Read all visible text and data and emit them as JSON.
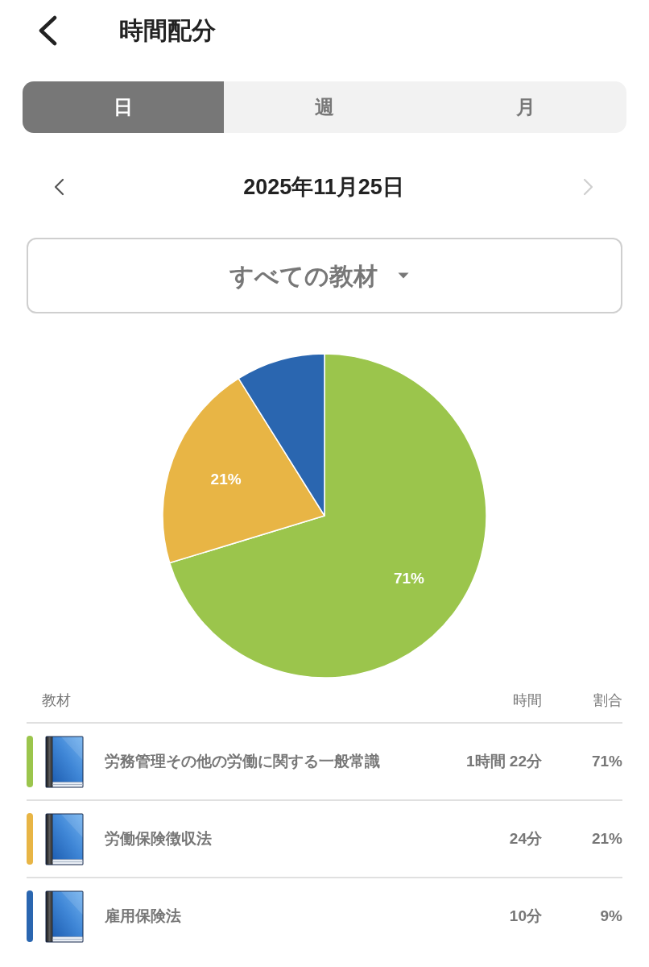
{
  "header": {
    "title": "時間配分"
  },
  "period_tabs": [
    {
      "label": "日",
      "selected": true
    },
    {
      "label": "週",
      "selected": false
    },
    {
      "label": "月",
      "selected": false
    }
  ],
  "date_nav": {
    "date": "2025年11月25日",
    "prev": {
      "disabled": false
    },
    "next": {
      "disabled": true
    }
  },
  "material_filter": {
    "value": "すべての教材"
  },
  "chart": {
    "chart_data": {
      "type": "pie",
      "values": [
        71,
        21,
        9
      ],
      "value_labels": [
        "71%",
        "21%",
        null
      ]
    }
  },
  "table": {
    "columns": [
      "教材",
      "時間",
      "割合"
    ],
    "rows": [
      {
        "color": "#9bc54c",
        "name": "労務管理その他の労働に関する一般常識",
        "time": "1時間 22分",
        "share": "71%"
      },
      {
        "color": "#e8b545",
        "name": "労働保険徴収法",
        "time": "24分",
        "share": "21%"
      },
      {
        "color": "#2a66b0",
        "name": "雇用保険法",
        "time": "10分",
        "share": "9%"
      }
    ]
  }
}
